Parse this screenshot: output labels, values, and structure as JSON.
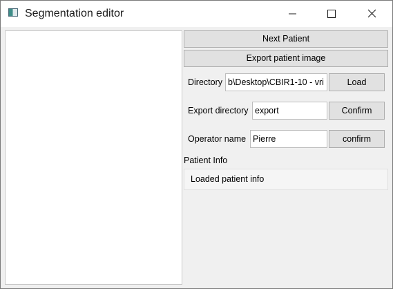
{
  "window": {
    "title": "Segmentation editor"
  },
  "controls": {
    "next_patient_label": "Next Patient",
    "export_image_label": "Export patient image",
    "directory_label": "Directory",
    "directory_value": "b\\Desktop\\CBIR1-10 - vri",
    "load_label": "Load",
    "export_directory_label": "Export directory",
    "export_directory_value": "export",
    "confirm_export_label": "Confirm",
    "operator_name_label": "Operator name",
    "operator_name_value": "Pierre",
    "confirm_operator_label": "confirm"
  },
  "patient_info": {
    "header": "Patient Info",
    "text": "Loaded patient info"
  },
  "icons": {
    "app": "app-window-icon",
    "minimize": "minimize-icon",
    "maximize": "maximize-icon",
    "close": "close-icon"
  }
}
